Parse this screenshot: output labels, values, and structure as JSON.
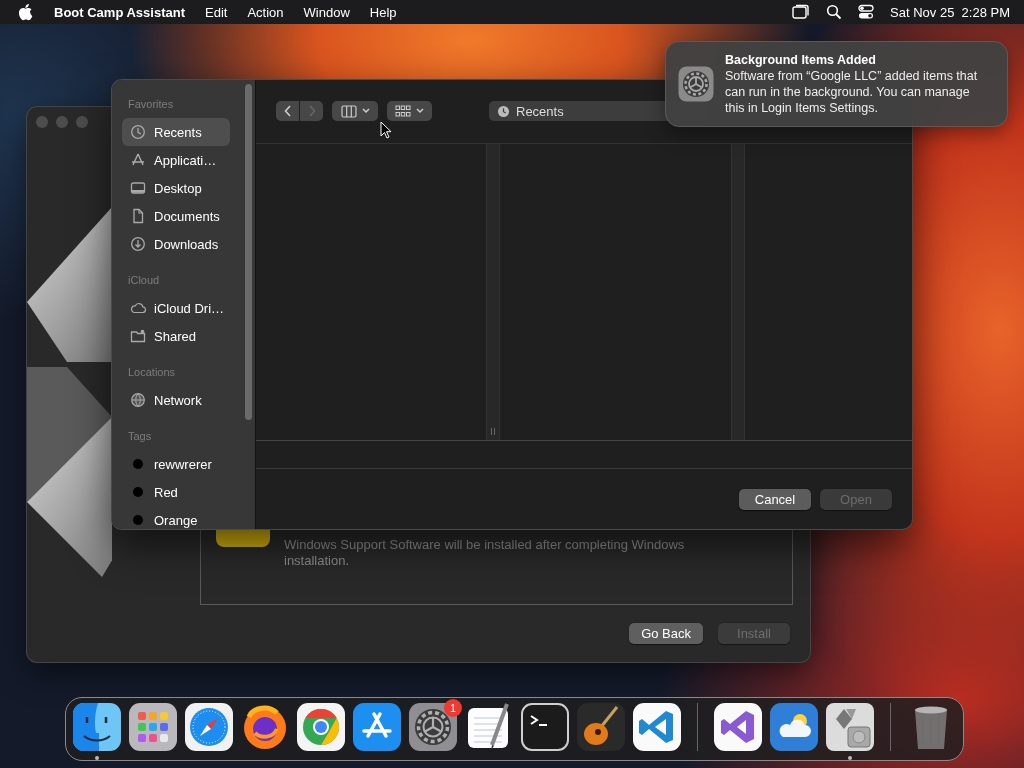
{
  "menu_bar": {
    "app_name": "Boot Camp Assistant",
    "menus": [
      "Edit",
      "Action",
      "Window",
      "Help"
    ],
    "clock": "Sat Nov 25  2:28 PM"
  },
  "boot_camp_window": {
    "message": "Windows Support Software will be installed after completing Windows installation.",
    "buttons": [
      {
        "label": "Go Back",
        "disabled": false
      },
      {
        "label": "Install",
        "disabled": true
      }
    ]
  },
  "open_dialog": {
    "sidebar": [
      {
        "heading": "Favorites",
        "items": [
          {
            "label": "Recents",
            "selected": true
          },
          {
            "label": "Applicati…",
            "selected": false
          },
          {
            "label": "Desktop",
            "selected": false
          },
          {
            "label": "Documents",
            "selected": false
          },
          {
            "label": "Downloads",
            "selected": false
          }
        ]
      },
      {
        "heading": "iCloud",
        "items": [
          {
            "label": "iCloud Dri…",
            "selected": false
          },
          {
            "label": "Shared",
            "selected": false
          }
        ]
      },
      {
        "heading": "Locations",
        "items": [
          {
            "label": "Network",
            "selected": false
          }
        ]
      },
      {
        "heading": "Tags",
        "items": [
          {
            "label": "rewwrerer",
            "color": "#000000",
            "selected": false
          },
          {
            "label": "Red",
            "color": "#000000",
            "selected": false
          },
          {
            "label": "Orange",
            "color": "#000000",
            "selected": false
          }
        ]
      }
    ],
    "location": "Recents",
    "buttons": [
      {
        "label": "Cancel",
        "disabled": false
      },
      {
        "label": "Open",
        "disabled": true
      }
    ]
  },
  "notification": {
    "title": "Background Items Added",
    "body": "Software from “Google LLC” added items that can run in the background. You can manage this in Login Items Settings."
  },
  "dock": {
    "groups": [
      {
        "items": [
          {
            "kind": "finder",
            "running": true
          },
          {
            "kind": "launchpad",
            "running": false
          },
          {
            "kind": "safari",
            "running": false
          },
          {
            "kind": "firefox",
            "running": false
          },
          {
            "kind": "chrome",
            "running": false
          },
          {
            "kind": "appstore",
            "running": false
          },
          {
            "kind": "settings",
            "running": false,
            "badge": "1"
          },
          {
            "kind": "textedit",
            "running": false
          },
          {
            "kind": "terminal",
            "running": false
          },
          {
            "kind": "garageband",
            "running": false
          },
          {
            "kind": "vscode",
            "running": false
          }
        ]
      },
      {
        "items": [
          {
            "kind": "visualstudio",
            "running": false
          },
          {
            "kind": "weather",
            "running": false
          },
          {
            "kind": "bootcamp",
            "running": true
          }
        ]
      },
      {
        "items": [
          {
            "kind": "trash",
            "running": false
          }
        ]
      }
    ]
  }
}
